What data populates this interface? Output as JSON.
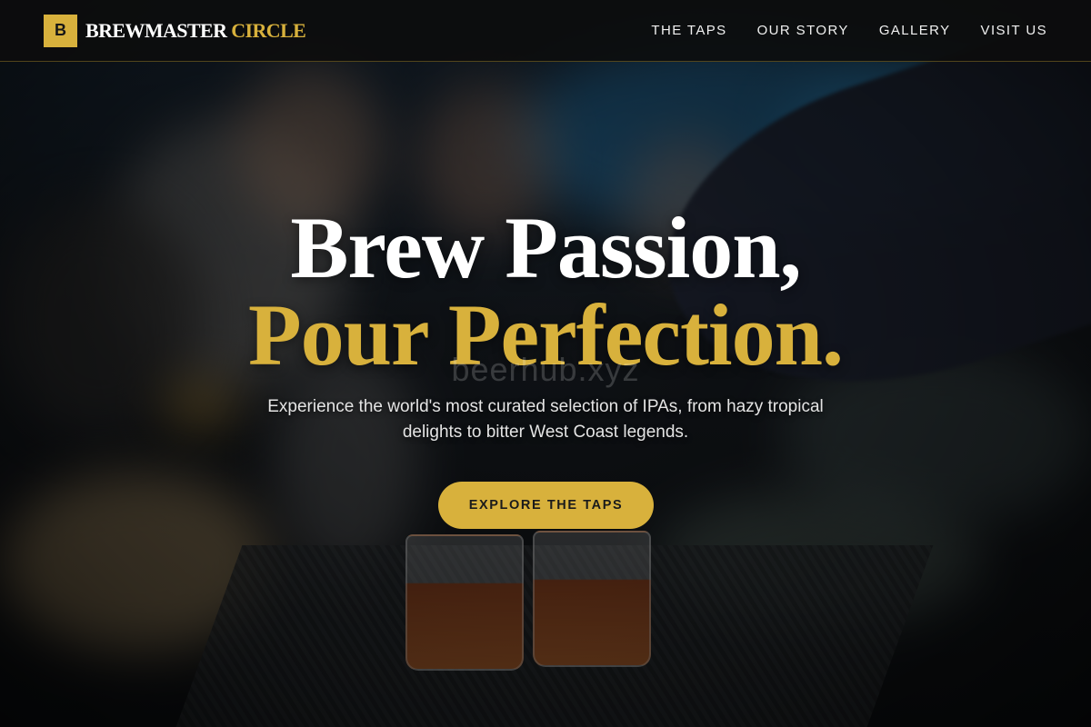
{
  "brand": {
    "mark": "B",
    "name_primary": "BREWMASTER",
    "name_accent": "CIRCLE"
  },
  "nav": {
    "items": [
      {
        "label": "THE TAPS"
      },
      {
        "label": "OUR STORY"
      },
      {
        "label": "GALLERY"
      },
      {
        "label": "VISIT US"
      }
    ]
  },
  "hero": {
    "headline_line1": "Brew Passion,",
    "headline_line2": "Pour Perfection.",
    "watermark": "beerhub.xyz",
    "subtitle": "Experience the world's most curated selection of IPAs, from hazy tropical delights to bitter West Coast legends.",
    "cta_label": "EXPLORE THE TAPS"
  },
  "colors": {
    "accent": "#d8b13c",
    "header_bg": "#0c0c0c",
    "text_primary": "#ffffff"
  }
}
